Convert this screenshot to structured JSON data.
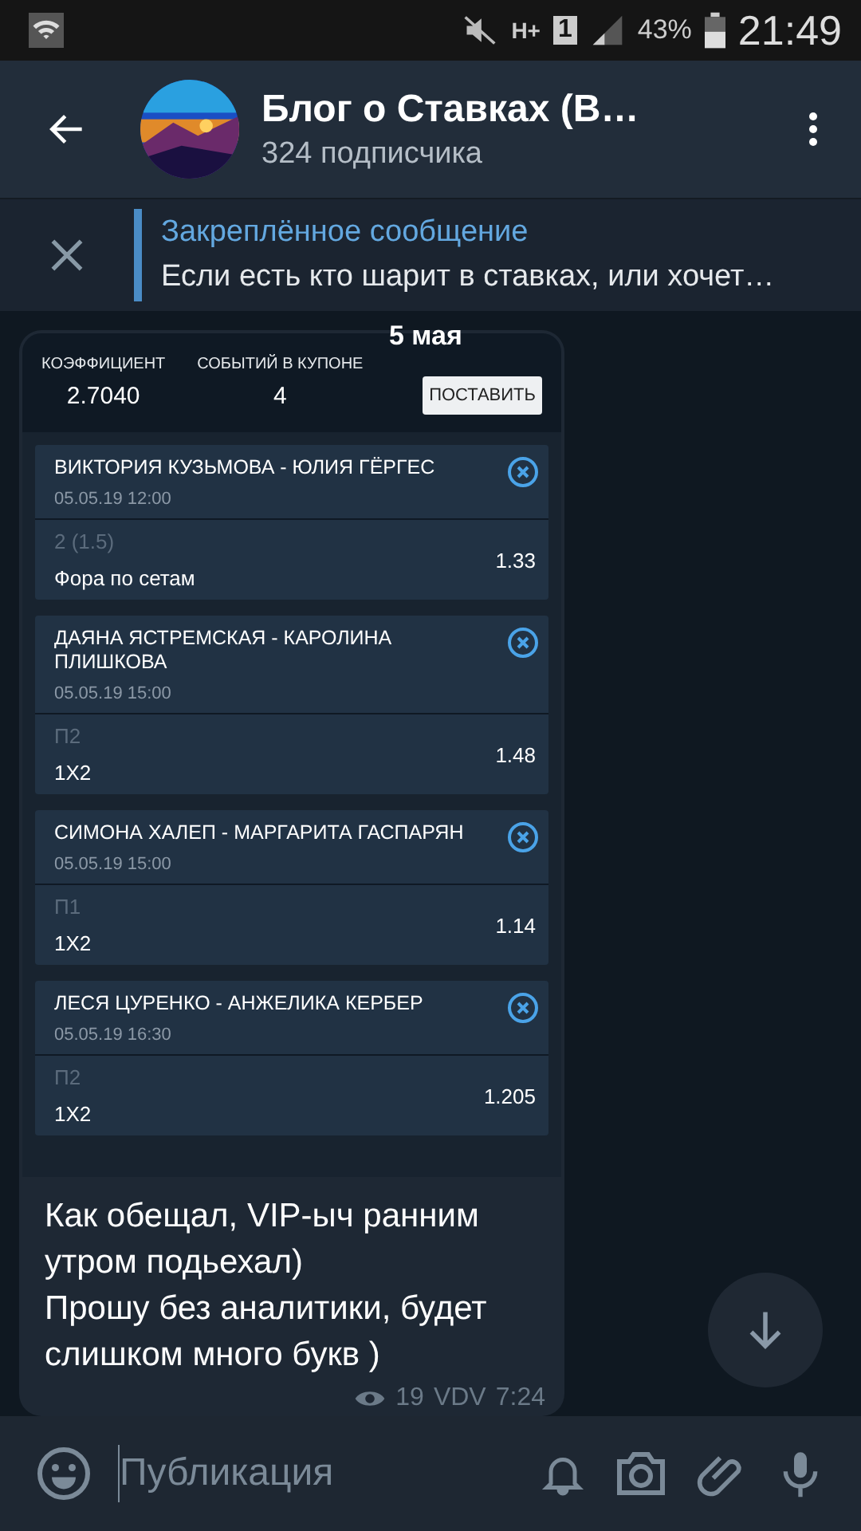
{
  "status_bar": {
    "network_type": "H+",
    "sim": "1",
    "battery": "43%",
    "time": "21:49"
  },
  "header": {
    "title": "Блог о Ставках (В…",
    "subtitle": "324 подписчика"
  },
  "pinned": {
    "label": "Закреплённое сообщение",
    "text": "Если есть кто шарит в ставках, или хочет…"
  },
  "date_badge": "5 мая",
  "coupon": {
    "coef_label": "КОЭФФИЦИЕНТ",
    "coef": "2.7040",
    "events_label": "СОБЫТИЙ В КУПОНЕ",
    "events": "4",
    "button": "ПОСТАВИТЬ",
    "bets": [
      {
        "match": "ВИКТОРИЯ КУЗЬМОВА - ЮЛИЯ ГЁРГЕС",
        "date": "05.05.19 12:00",
        "pick": "2 (1.5)",
        "market": "Фора по сетам",
        "odds": "1.33"
      },
      {
        "match": "ДАЯНА ЯСТРЕМСКАЯ - КАРОЛИНА ПЛИШКОВА",
        "date": "05.05.19 15:00",
        "pick": "П2",
        "market": "1X2",
        "odds": "1.48"
      },
      {
        "match": "СИМОНА ХАЛЕП - МАРГАРИТА ГАСПАРЯН",
        "date": "05.05.19 15:00",
        "pick": "П1",
        "market": "1X2",
        "odds": "1.14"
      },
      {
        "match": "ЛЕСЯ ЦУРЕНКО - АНЖЕЛИКА КЕРБЕР",
        "date": "05.05.19 16:30",
        "pick": "П2",
        "market": "1X2",
        "odds": "1.205"
      }
    ]
  },
  "message": {
    "text": "Как обещал, VIP-ыч ранним утром подьехал)\nПрошу без аналитики, будет слишком много букв )",
    "views": "19",
    "author": "VDV",
    "time": "7:24"
  },
  "composer": {
    "placeholder": "Публикация"
  }
}
